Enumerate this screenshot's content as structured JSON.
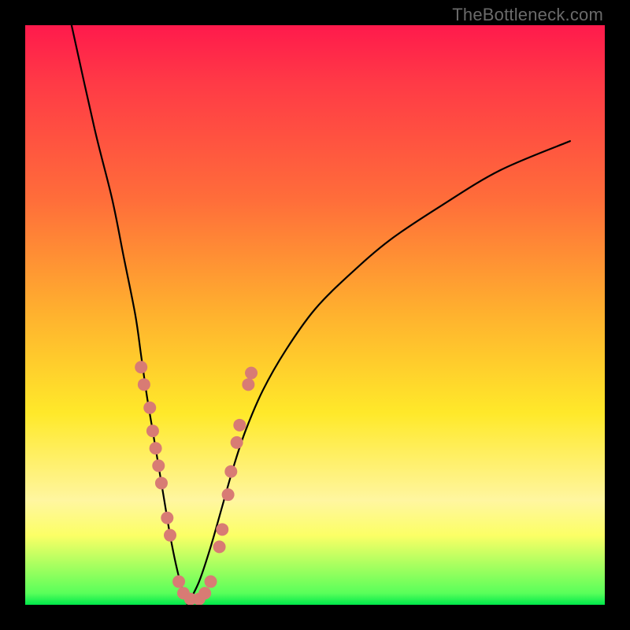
{
  "watermark": "TheBottleneck.com",
  "colors": {
    "background": "#000000",
    "curve_stroke": "#000000",
    "dot_fill": "#d87b74",
    "gradient_top": "#ff1a4c",
    "gradient_bottom": "#00e84b"
  },
  "chart_data": {
    "type": "line",
    "title": "",
    "xlabel": "",
    "ylabel": "",
    "xlim": [
      0,
      100
    ],
    "ylim": [
      0,
      100
    ],
    "note": "Axis values are approximate percentages inferred from plot position; no tick labels are present in the image.",
    "series": [
      {
        "name": "left-branch",
        "x": [
          8,
          12,
          15,
          17,
          19,
          20,
          21,
          22,
          23,
          24,
          25,
          26,
          27,
          28
        ],
        "y": [
          100,
          82,
          70,
          60,
          50,
          43,
          36,
          30,
          24,
          18,
          12,
          7,
          3,
          0
        ]
      },
      {
        "name": "right-branch",
        "x": [
          28,
          30,
          32,
          34,
          36,
          38,
          41,
          45,
          50,
          56,
          63,
          72,
          82,
          94
        ],
        "y": [
          0,
          4,
          10,
          17,
          24,
          30,
          37,
          44,
          51,
          57,
          63,
          69,
          75,
          80
        ]
      }
    ],
    "scatter_points": {
      "name": "dots",
      "points": [
        {
          "x": 20.0,
          "y": 41
        },
        {
          "x": 20.5,
          "y": 38
        },
        {
          "x": 21.5,
          "y": 34
        },
        {
          "x": 22.0,
          "y": 30
        },
        {
          "x": 22.5,
          "y": 27
        },
        {
          "x": 23.0,
          "y": 24
        },
        {
          "x": 23.5,
          "y": 21
        },
        {
          "x": 24.5,
          "y": 15
        },
        {
          "x": 25.0,
          "y": 12
        },
        {
          "x": 26.5,
          "y": 4
        },
        {
          "x": 27.3,
          "y": 2
        },
        {
          "x": 28.5,
          "y": 1
        },
        {
          "x": 30.0,
          "y": 1
        },
        {
          "x": 31.0,
          "y": 2
        },
        {
          "x": 32.0,
          "y": 4
        },
        {
          "x": 33.5,
          "y": 10
        },
        {
          "x": 34.0,
          "y": 13
        },
        {
          "x": 35.0,
          "y": 19
        },
        {
          "x": 35.5,
          "y": 23
        },
        {
          "x": 36.5,
          "y": 28
        },
        {
          "x": 37.0,
          "y": 31
        },
        {
          "x": 38.5,
          "y": 38
        },
        {
          "x": 39.0,
          "y": 40
        }
      ]
    }
  }
}
